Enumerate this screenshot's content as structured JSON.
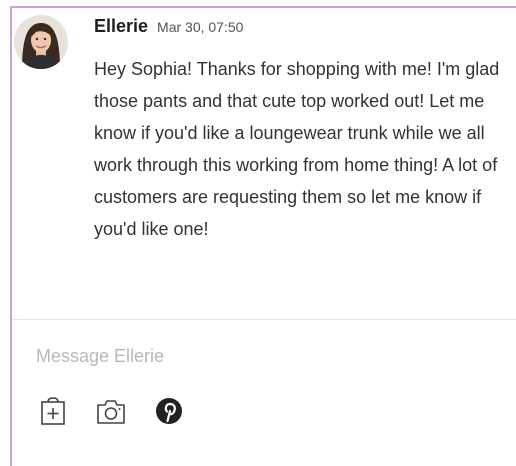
{
  "message": {
    "sender": "Ellerie",
    "timestamp": "Mar 30, 07:50",
    "body": "Hey Sophia! Thanks for shopping with me! I'm glad those pants and that cute top worked out! Let me know if you'd like a loungewear trunk while we all work through this working from home thing! A lot of customers are requesting them so let me know if you'd like one!"
  },
  "composer": {
    "placeholder": "Message Ellerie"
  },
  "toolbar": {
    "icons": [
      "add-to-box-icon",
      "camera-icon",
      "pinterest-icon"
    ]
  },
  "colors": {
    "frame_border": "#c9a6cf",
    "placeholder": "#b8b8b8",
    "icon": "#444444"
  }
}
